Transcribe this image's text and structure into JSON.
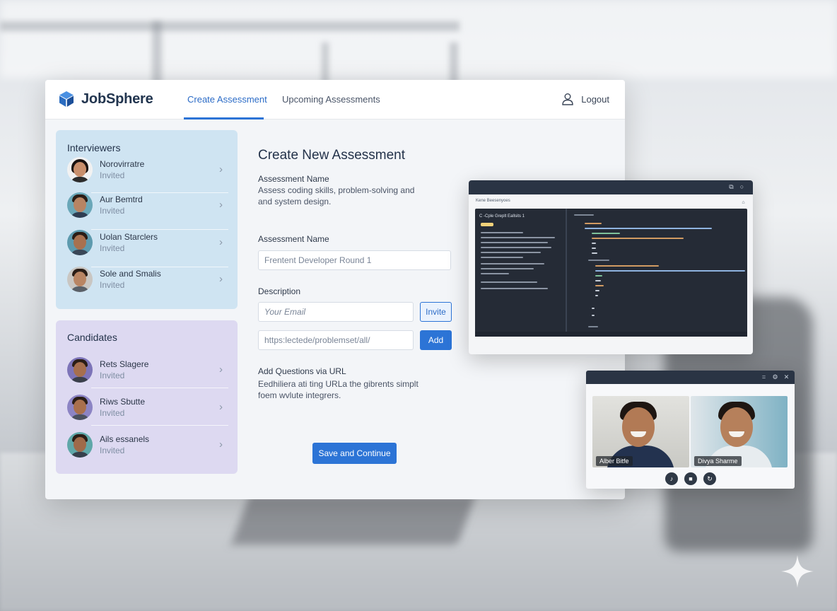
{
  "brand": {
    "name": "JobSphere",
    "accent": "#2c74d6"
  },
  "nav": {
    "tabs": [
      {
        "label": "Create Assessment",
        "active": true
      },
      {
        "label": "Upcoming Assessments",
        "active": false
      }
    ],
    "logout_label": "Logout"
  },
  "interviewers": {
    "title": "Interviewers",
    "items": [
      {
        "name": "Norovirratre",
        "status": "Invited"
      },
      {
        "name": "Aur Bemtrd",
        "status": "Invited"
      },
      {
        "name": "Uolan Starclers",
        "status": "Invited"
      },
      {
        "name": "Sole and Smalis",
        "status": "Invited"
      }
    ]
  },
  "candidates": {
    "title": "Candidates",
    "items": [
      {
        "name": "Rets Slagere",
        "status": "Invited"
      },
      {
        "name": "Riws Sbutte",
        "status": "Invited"
      },
      {
        "name": "Ails essanels",
        "status": "Invited"
      }
    ]
  },
  "form": {
    "title": "Create New Assessment",
    "intro_label": "Assessment Name",
    "intro_help_1": "Assess coding skills, problem-solving  and",
    "intro_help_2": "and system design.",
    "name_label": "Assessment Name",
    "name_value": "Frentent Developer Round 1",
    "description_label": "Description",
    "email_placeholder": "Your Email",
    "invite_label": "Invite",
    "url_value": "https:lectede/problemset/all/",
    "add_label": "Add",
    "questions_label": "Add Questions via URL",
    "questions_help_1": "Eedhiliera ati ting URLa the gibrents simplt",
    "questions_help_2": "foem wvlute integrers.",
    "save_label": "Save and Continue"
  },
  "editor": {
    "header": "Kene Beesenyoes",
    "side_title": "C -Cple Greplt Eallsits 1"
  },
  "video_call": {
    "participants": [
      {
        "name": "Alber Bitfe"
      },
      {
        "name": "Divya Sharme"
      }
    ]
  }
}
